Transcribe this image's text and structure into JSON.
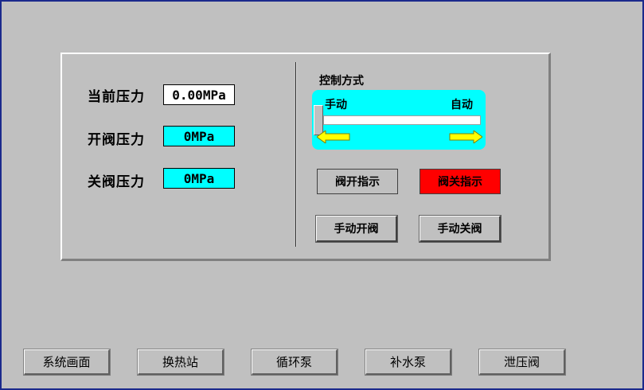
{
  "pressure": {
    "current_label": "当前压力",
    "current_value": "0.00MPa",
    "open_label": "开阀压力",
    "open_value": "0MPa",
    "close_label": "关阀压力",
    "close_value": "0MPa"
  },
  "control": {
    "title": "控制方式",
    "manual_label": "手动",
    "auto_label": "自动",
    "mode": "手动",
    "slider_level": 0
  },
  "indicators": {
    "valve_open": "阀开指示",
    "valve_close": "阀关指示",
    "valve_close_color": "#ff0000"
  },
  "actions": {
    "manual_open": "手动开阀",
    "manual_close": "手动关阀"
  },
  "nav": {
    "items": [
      "系统画面",
      "换热站",
      "循环泵",
      "补水泵",
      "泄压阀"
    ]
  },
  "colors": {
    "background": "#c0c0c0",
    "accent_cyan": "#00ffff",
    "arrow_yellow": "#ffff00"
  },
  "icons": {
    "left": "arrow-left-icon",
    "right": "arrow-right-icon"
  }
}
